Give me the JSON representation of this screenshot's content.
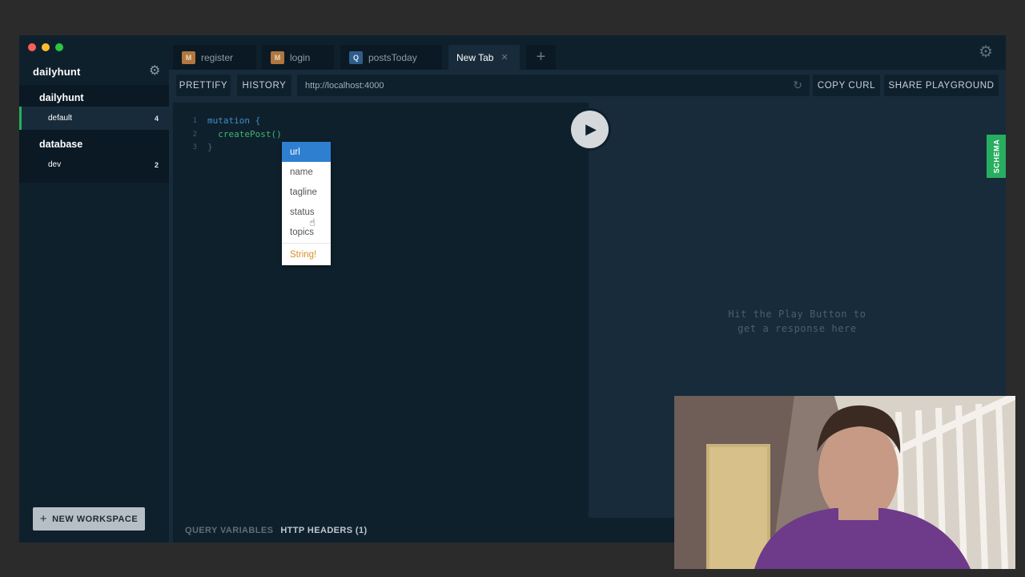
{
  "sidebar": {
    "workspace_title": "dailyhunt",
    "projects": [
      {
        "name": "dailyhunt",
        "environments": [
          {
            "name": "default",
            "count": "4",
            "active": true
          }
        ]
      },
      {
        "name": "database",
        "environments": [
          {
            "name": "dev",
            "count": "2",
            "active": false
          }
        ]
      }
    ],
    "new_workspace_label": "NEW WORKSPACE"
  },
  "tabs": [
    {
      "badge": "M",
      "label": "register"
    },
    {
      "badge": "M",
      "label": "login"
    },
    {
      "badge": "Q",
      "label": "postsToday"
    },
    {
      "badge": "",
      "label": "New Tab"
    }
  ],
  "toolbar": {
    "prettify": "PRETTIFY",
    "history": "HISTORY",
    "url": "http://localhost:4000",
    "copy_curl": "COPY CURL",
    "share": "SHARE PLAYGROUND"
  },
  "editor": {
    "lines": [
      {
        "num": "1",
        "code": "mutation {"
      },
      {
        "num": "2",
        "code": "  createPost()"
      },
      {
        "num": "3",
        "code": "}"
      }
    ],
    "autocomplete": {
      "items": [
        "url",
        "name",
        "tagline",
        "status",
        "topics"
      ],
      "selected": "url",
      "type": "String!"
    }
  },
  "result": {
    "hint_line1": "Hit the Play Button to",
    "hint_line2": "get a response here"
  },
  "schema_label": "SCHEMA",
  "bottom": {
    "query_variables": "QUERY VARIABLES",
    "http_headers": "HTTP HEADERS (1)"
  },
  "colors": {
    "accent_green": "#27ae60",
    "selection_blue": "#2f7fd0",
    "type_orange": "#d8902a"
  }
}
